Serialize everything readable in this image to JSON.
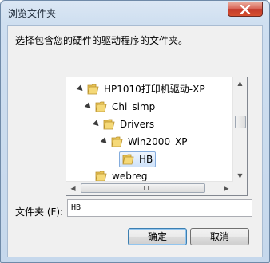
{
  "window": {
    "title": "浏览文件夹"
  },
  "prompt": "选择包含您的硬件的驱动程序的文件夹。",
  "tree": {
    "items": [
      {
        "label": "HP1010打印机驱动-XP",
        "expanded": true,
        "selected": false
      },
      {
        "label": "Chi_simp",
        "expanded": true,
        "selected": false
      },
      {
        "label": "Drivers",
        "expanded": true,
        "selected": false
      },
      {
        "label": "Win2000_XP",
        "expanded": true,
        "selected": false
      },
      {
        "label": "HB",
        "expanded": false,
        "selected": true
      },
      {
        "label": "webreg",
        "expanded": false,
        "selected": false
      }
    ]
  },
  "folder_field": {
    "label": "文件夹 (F):",
    "value": "HB"
  },
  "buttons": {
    "ok": "确定",
    "cancel": "取消"
  },
  "colors": {
    "folder": "#e8c455",
    "selection": "#cfe3fa",
    "close": "#c33a2b"
  },
  "icons": {
    "folder": "folder-icon",
    "close": "close-icon",
    "expand": "expand-arrow-icon"
  }
}
